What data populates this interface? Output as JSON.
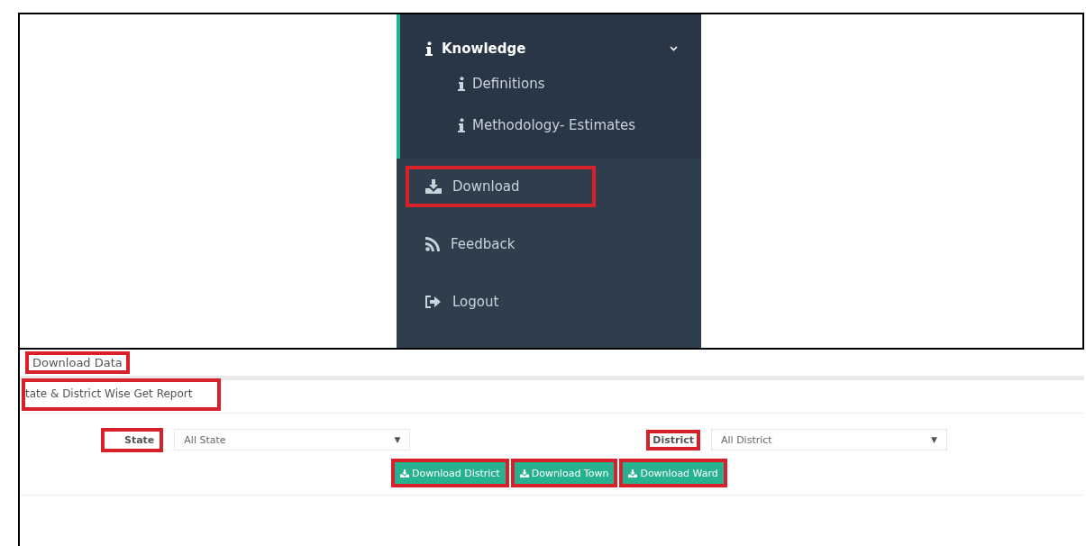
{
  "sidebar": {
    "items": [
      {
        "label": "Knowledge",
        "expanded": true,
        "highlighted": false,
        "children": [
          {
            "label": "Definitions"
          },
          {
            "label": "Methodology- Estimates"
          }
        ]
      },
      {
        "label": "Download",
        "expanded": false,
        "highlighted": true
      },
      {
        "label": "Feedback",
        "expanded": false,
        "highlighted": false
      },
      {
        "label": "Logout",
        "expanded": false,
        "highlighted": false
      }
    ]
  },
  "download_panel": {
    "title": {
      "text": "Download Data",
      "highlighted": true
    },
    "subtitle": {
      "text": "tate & District Wise Get Report",
      "highlighted": true
    },
    "fields": [
      {
        "label": "State",
        "value": "All State",
        "caret": "▼",
        "highlighted": true
      },
      {
        "label": "District",
        "value": "All District",
        "caret": "▼",
        "highlighted": true
      }
    ],
    "buttons": [
      {
        "label": "Download District",
        "highlighted": true
      },
      {
        "label": "Download Town",
        "highlighted": true
      },
      {
        "label": "Download Ward",
        "highlighted": true
      }
    ]
  }
}
